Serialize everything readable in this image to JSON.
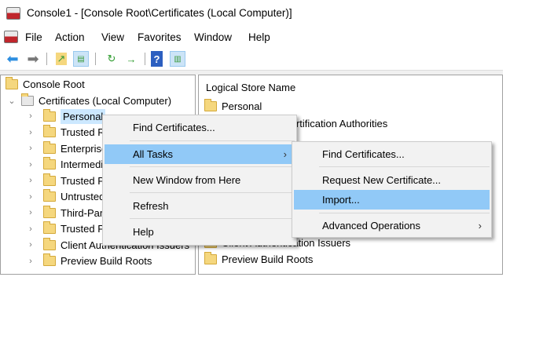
{
  "window": {
    "title": "Console1 - [Console Root\\Certificates (Local Computer)]"
  },
  "menubar": [
    "File",
    "Action",
    "View",
    "Favorites",
    "Window",
    "Help"
  ],
  "toolbar": {
    "icons": [
      "back-arrow-icon",
      "forward-arrow-icon",
      "up-folder-icon",
      "show-hide-tree-icon",
      "refresh-icon",
      "export-list-icon",
      "help-icon",
      "show-hide-action-pane-icon"
    ]
  },
  "tree": {
    "root": "Console Root",
    "certificates": "Certificates (Local Computer)",
    "children": [
      "Personal",
      "Trusted Root Certification Authorities",
      "Enterprise Trust",
      "Intermediate Certification Authorities",
      "Trusted Publishers",
      "Untrusted Certificates",
      "Third-Party Root Certification Authorities",
      "Trusted People",
      "Client Authentication Issuers",
      "Preview Build Roots"
    ]
  },
  "list": {
    "header": "Logical Store Name",
    "items": [
      "Personal",
      "Trusted Root Certification Authorities",
      "Client Authentication Issuers",
      "Preview Build Roots"
    ]
  },
  "context_menu": [
    "Find Certificates...",
    "All Tasks",
    "New Window from Here",
    "Refresh",
    "Help"
  ],
  "submenu": [
    "Find Certificates...",
    "Request New Certificate...",
    "Import...",
    "Advanced Operations"
  ],
  "colors": {
    "highlight": "#91c9f7",
    "selection": "#cce8ff"
  }
}
